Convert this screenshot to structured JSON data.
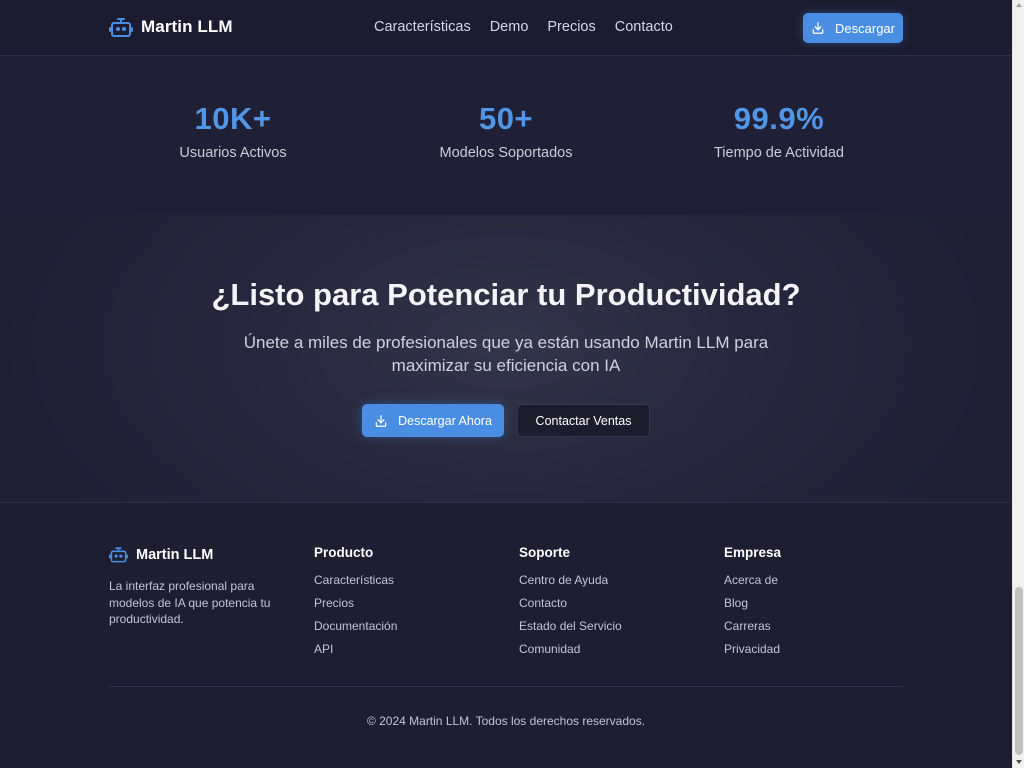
{
  "nav": {
    "brand": "Martin LLM",
    "links": [
      "Características",
      "Demo",
      "Precios",
      "Contacto"
    ],
    "download_label": "Descargar"
  },
  "stats": [
    {
      "value": "10K+",
      "label": "Usuarios Activos"
    },
    {
      "value": "50+",
      "label": "Modelos Soportados"
    },
    {
      "value": "99.9%",
      "label": "Tiempo de Actividad"
    }
  ],
  "cta": {
    "title": "¿Listo para Potenciar tu Productividad?",
    "subtitle": "Únete a miles de profesionales que ya están usando Martin LLM para maximizar su eficiencia con IA",
    "primary_label": "Descargar Ahora",
    "secondary_label": "Contactar Ventas"
  },
  "footer": {
    "brand": "Martin LLM",
    "description": "La interfaz profesional para modelos de IA que potencia tu productividad.",
    "columns": [
      {
        "title": "Producto",
        "links": [
          "Características",
          "Precios",
          "Documentación",
          "API"
        ]
      },
      {
        "title": "Soporte",
        "links": [
          "Centro de Ayuda",
          "Contacto",
          "Estado del Servicio",
          "Comunidad"
        ]
      },
      {
        "title": "Empresa",
        "links": [
          "Acerca de",
          "Blog",
          "Carreras",
          "Privacidad"
        ]
      }
    ],
    "copyright": "© 2024 Martin LLM. Todos los derechos reservados."
  },
  "colors": {
    "accent": "#4a8ee3",
    "stat_value": "#5196e6",
    "background": "#1e1f33"
  },
  "icons": {
    "brand": "robot-icon",
    "download": "download-icon"
  }
}
